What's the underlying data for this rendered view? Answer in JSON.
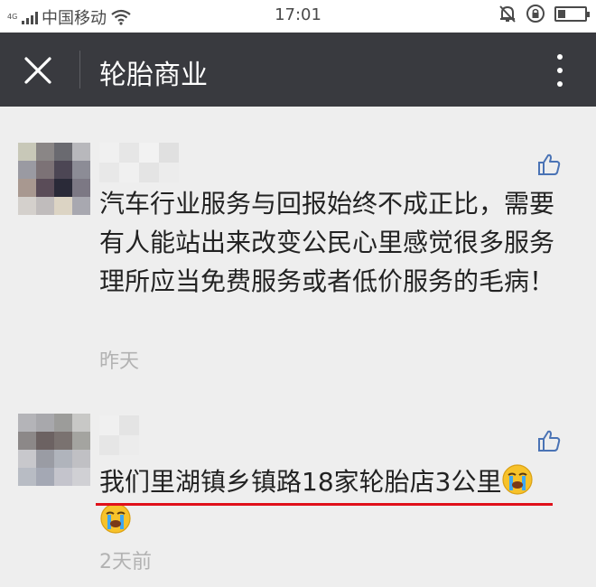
{
  "status_bar": {
    "network_type": "4G",
    "carrier": "中国移动",
    "time": "17:01",
    "icons": [
      "signal-icon",
      "wifi-icon",
      "mute-bell-icon",
      "rotation-lock-icon",
      "battery-icon"
    ]
  },
  "nav": {
    "title": "轮胎商业",
    "close_icon": "close-icon",
    "more_icon": "more-vertical-icon"
  },
  "comments": [
    {
      "author_name_obscured": true,
      "text": "汽车行业服务与回报始终不成正比，需要有人能站出来改变公民心里感觉很多服务理所应当免费服务或者低价服务的毛病！",
      "time": "昨天",
      "like_icon": "thumbs-up-icon"
    },
    {
      "author_name_obscured": true,
      "text": "我们里湖镇乡镇路18家轮胎店3公里",
      "emoji": "crying-face-emoji",
      "time": "2天前",
      "like_icon": "thumbs-up-icon",
      "highlight_color": "#e0101a"
    }
  ],
  "colors": {
    "nav_bg": "#393a3f",
    "page_bg": "#eeeeee",
    "text": "#222222",
    "time_text": "#b2b2b2",
    "like_icon": "#4a73b5",
    "underline": "#e0101a"
  }
}
